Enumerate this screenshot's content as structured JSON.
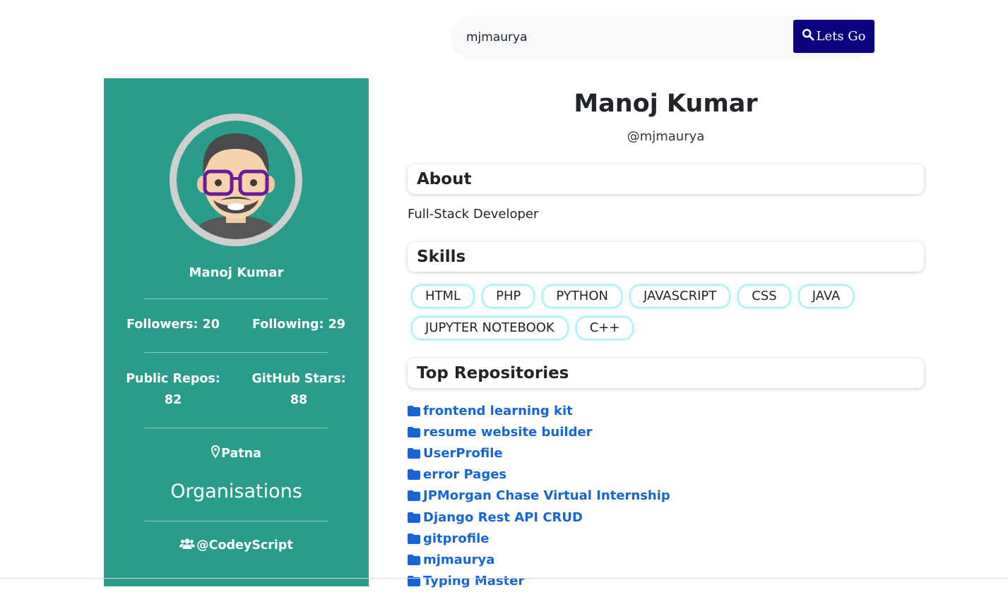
{
  "search": {
    "value": "mjmaurya",
    "button_label": "Lets Go"
  },
  "sidebar": {
    "name": "Manoj Kumar",
    "followers": "Followers: 20",
    "following": "Following: 29",
    "public_repos_label": "Public Repos:",
    "public_repos_value": "82",
    "stars_label": "GitHub Stars:",
    "stars_value": "88",
    "location": "Patna",
    "organisations_title": "Organisations",
    "organisation": "@CodeyScript"
  },
  "profile": {
    "name": "Manoj Kumar",
    "handle": "@mjmaurya",
    "about_heading": "About",
    "about_text": "Full-Stack Developer",
    "skills_heading": "Skills",
    "skills": [
      "HTML",
      "PHP",
      "PYTHON",
      "JAVASCRIPT",
      "CSS",
      "JAVA",
      "JUPYTER NOTEBOOK",
      "C++"
    ],
    "repos_heading": "Top Repositories",
    "repos": [
      "frontend learning kit",
      "resume website builder",
      "UserProfile",
      "error Pages",
      "JPMorgan Chase Virtual Internship",
      "Django Rest API CRUD",
      "gitprofile",
      "mjmaurya",
      "Typing Master"
    ]
  },
  "colors": {
    "sidebar_bg": "#2a9c8c",
    "button_bg": "#0b0080",
    "link": "#1565d8",
    "skill_border": "#a8f0f4"
  },
  "icons": {
    "search": "search-icon",
    "location": "map-marker-icon",
    "organisation": "users-icon",
    "repo": "folder-icon"
  }
}
